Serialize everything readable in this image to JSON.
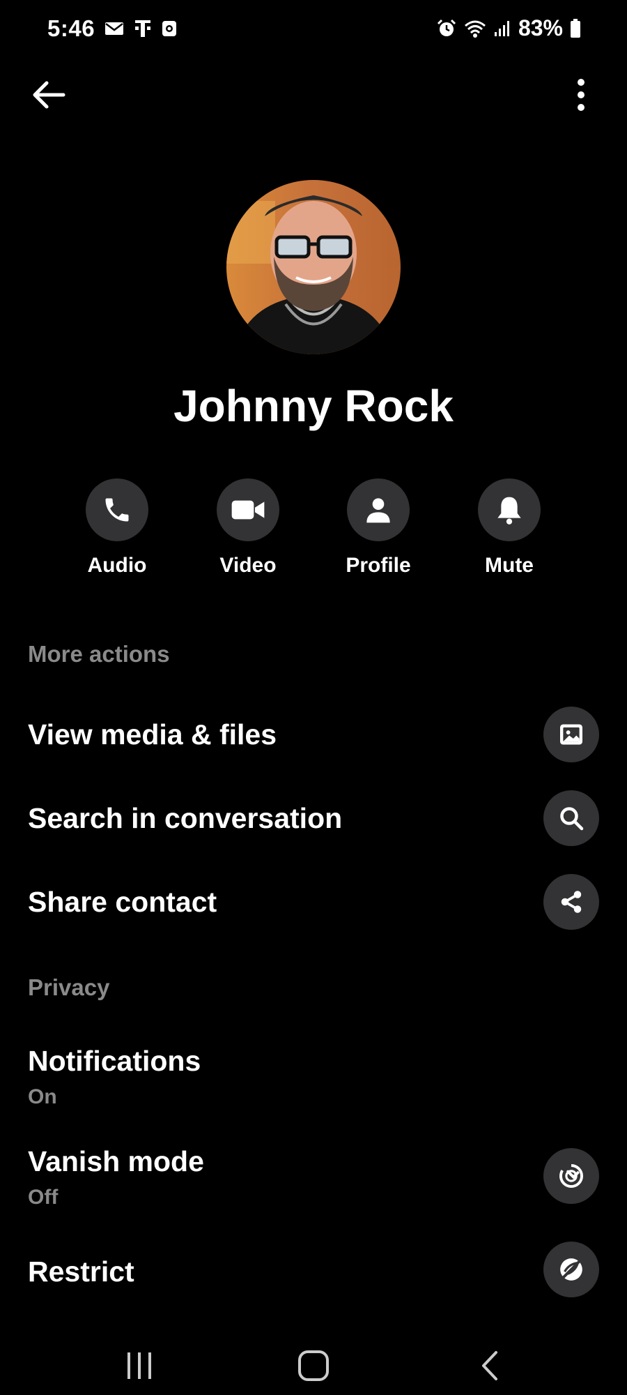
{
  "status_bar": {
    "time": "5:46",
    "battery": "83%",
    "icons_left": [
      "mail-icon",
      "tmobile-icon",
      "app-notification-icon"
    ],
    "icons_right": [
      "alarm-icon",
      "wifi-icon",
      "signal-icon",
      "battery-icon"
    ]
  },
  "header": {
    "back_icon": "arrow-left-icon",
    "more_icon": "vertical-dots-icon"
  },
  "contact": {
    "name": "Johnny Rock"
  },
  "quick_actions": [
    {
      "label": "Audio",
      "icon": "phone-icon"
    },
    {
      "label": "Video",
      "icon": "video-camera-icon"
    },
    {
      "label": "Profile",
      "icon": "person-icon"
    },
    {
      "label": "Mute",
      "icon": "bell-icon"
    }
  ],
  "more_actions": {
    "title": "More actions",
    "items": [
      {
        "label": "View media & files",
        "icon": "image-icon"
      },
      {
        "label": "Search in conversation",
        "icon": "search-icon"
      },
      {
        "label": "Share contact",
        "icon": "share-icon"
      }
    ]
  },
  "privacy": {
    "title": "Privacy",
    "items": [
      {
        "label": "Notifications",
        "value": "On"
      },
      {
        "label": "Vanish mode",
        "value": "Off",
        "icon": "vanish-mode-icon"
      },
      {
        "label": "Restrict",
        "icon": "restrict-icon"
      }
    ]
  },
  "colors": {
    "background": "#000000",
    "text": "#ffffff",
    "muted": "#8a8a8a",
    "button_bg": "#333335"
  }
}
